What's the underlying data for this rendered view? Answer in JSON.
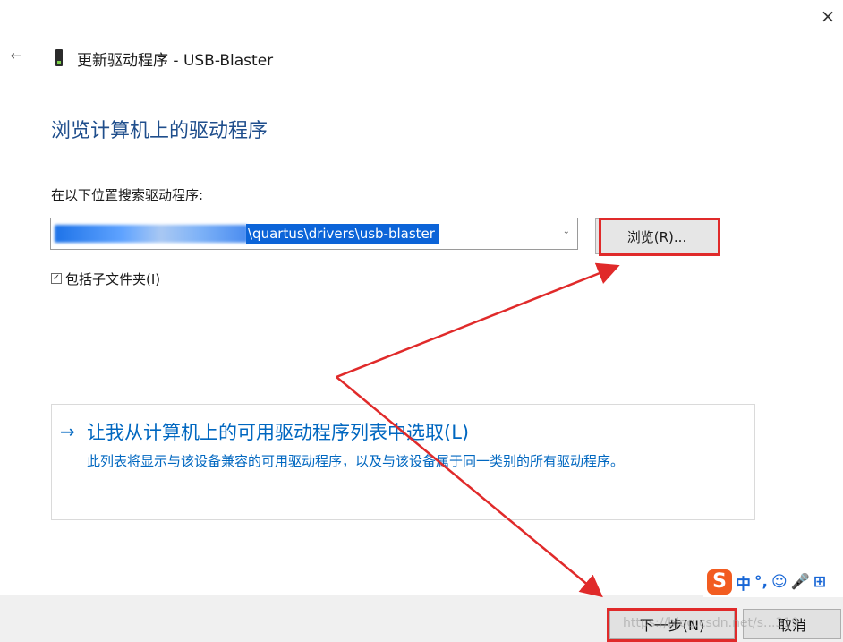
{
  "window": {
    "close_icon": "×",
    "back_icon": "←",
    "device_icon": "usb-device-icon",
    "title": "更新驱动程序 - USB-Blaster"
  },
  "page": {
    "heading": "浏览计算机上的驱动程序",
    "search_label": "在以下位置搜索驱动程序:",
    "path_value_visible": "\\quartus\\drivers\\usb-blaster",
    "browse_label": "浏览(R)...",
    "include_subfolders_label": "包括子文件夹(I)",
    "include_subfolders_checked": true
  },
  "pick_option": {
    "arrow": "→",
    "title": "让我从计算机上的可用驱动程序列表中选取(L)",
    "description": "此列表将显示与该设备兼容的可用驱动程序，以及与该设备属于同一类别的所有驱动程序。"
  },
  "footer": {
    "next_label": "下一步(N)",
    "cancel_label": "取消"
  },
  "ime": {
    "logo": "S",
    "items": [
      "中",
      "°,",
      "☺",
      "🎤",
      "⊞"
    ]
  },
  "watermark": "https://blog.csdn.net/s...319",
  "colors": {
    "accent_link": "#0067c0",
    "heading": "#1f4e8c",
    "annotation_red": "#e02a2a",
    "selection": "#0c64d8"
  }
}
